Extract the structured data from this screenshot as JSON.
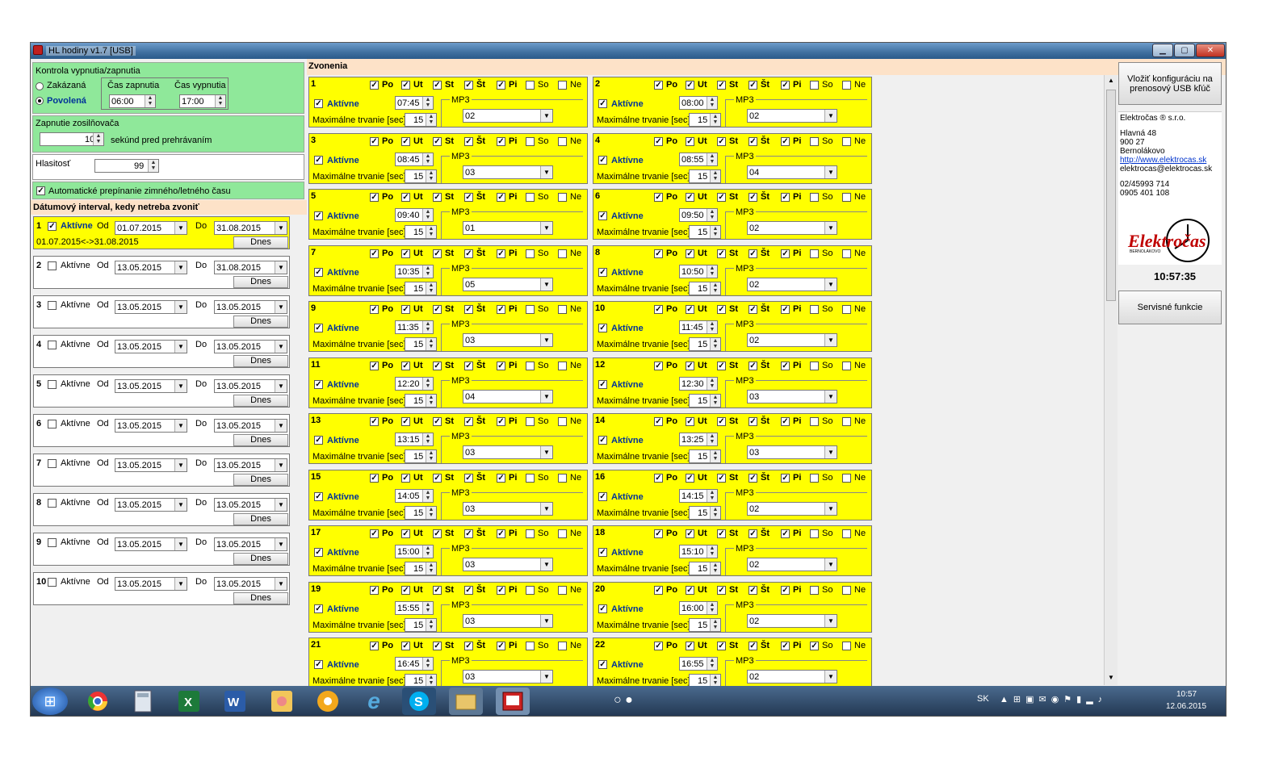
{
  "window": {
    "title": "HL hodiny v1.7  [USB]"
  },
  "power": {
    "heading": "Kontrola vypnutia/zapnutia",
    "disabled": "Zakázaná",
    "enabled": "Povolená",
    "on_time_label": "Čas zapnutia",
    "off_time_label": "Čas vypnutia",
    "on_time": "06:00",
    "off_time": "17:00"
  },
  "amp": {
    "heading": "Zapnutie zosilňovača",
    "value": "10",
    "suffix": "sekúnd pred prehrávaním"
  },
  "volume": {
    "label": "Hlasitosť",
    "value": "99"
  },
  "dst": {
    "label": "Automatické prepínanie zimného/letného času"
  },
  "dates": {
    "heading": "Dátumový interval, kedy netreba zvoniť",
    "active_label": "Aktívne",
    "from_label": "Od",
    "to_label": "Do",
    "today_label": "Dnes",
    "items": [
      {
        "n": "1",
        "from": "01.07.2015",
        "to": "31.08.2015",
        "active": true,
        "range": "01.07.2015<->31.08.2015"
      },
      {
        "n": "2",
        "from": "13.05.2015",
        "to": "31.08.2015",
        "active": false,
        "range": ""
      },
      {
        "n": "3",
        "from": "13.05.2015",
        "to": "13.05.2015",
        "active": false,
        "range": ""
      },
      {
        "n": "4",
        "from": "13.05.2015",
        "to": "13.05.2015",
        "active": false,
        "range": ""
      },
      {
        "n": "5",
        "from": "13.05.2015",
        "to": "13.05.2015",
        "active": false,
        "range": ""
      },
      {
        "n": "6",
        "from": "13.05.2015",
        "to": "13.05.2015",
        "active": false,
        "range": ""
      },
      {
        "n": "7",
        "from": "13.05.2015",
        "to": "13.05.2015",
        "active": false,
        "range": ""
      },
      {
        "n": "8",
        "from": "13.05.2015",
        "to": "13.05.2015",
        "active": false,
        "range": ""
      },
      {
        "n": "9",
        "from": "13.05.2015",
        "to": "13.05.2015",
        "active": false,
        "range": ""
      },
      {
        "n": "10",
        "from": "13.05.2015",
        "to": "13.05.2015",
        "active": false,
        "range": ""
      }
    ]
  },
  "bells": {
    "heading": "Zvonenia",
    "active_label": "Aktívne",
    "duration_label": "Maximálne trvanie [sec]",
    "mp3_label": "MP3",
    "days": [
      "Po",
      "Ut",
      "St",
      "Št",
      "Pi",
      "So",
      "Ne"
    ],
    "items": [
      {
        "n": "1",
        "time": "07:45",
        "dur": "15",
        "mp3": "02"
      },
      {
        "n": "2",
        "time": "08:00",
        "dur": "15",
        "mp3": "02"
      },
      {
        "n": "3",
        "time": "08:45",
        "dur": "15",
        "mp3": "03"
      },
      {
        "n": "4",
        "time": "08:55",
        "dur": "15",
        "mp3": "04"
      },
      {
        "n": "5",
        "time": "09:40",
        "dur": "15",
        "mp3": "01"
      },
      {
        "n": "6",
        "time": "09:50",
        "dur": "15",
        "mp3": "02"
      },
      {
        "n": "7",
        "time": "10:35",
        "dur": "15",
        "mp3": "05"
      },
      {
        "n": "8",
        "time": "10:50",
        "dur": "15",
        "mp3": "02"
      },
      {
        "n": "9",
        "time": "11:35",
        "dur": "15",
        "mp3": "03"
      },
      {
        "n": "10",
        "time": "11:45",
        "dur": "15",
        "mp3": "02"
      },
      {
        "n": "11",
        "time": "12:20",
        "dur": "15",
        "mp3": "04"
      },
      {
        "n": "12",
        "time": "12:30",
        "dur": "15",
        "mp3": "03"
      },
      {
        "n": "13",
        "time": "13:15",
        "dur": "15",
        "mp3": "03"
      },
      {
        "n": "14",
        "time": "13:25",
        "dur": "15",
        "mp3": "03"
      },
      {
        "n": "15",
        "time": "14:05",
        "dur": "15",
        "mp3": "03"
      },
      {
        "n": "16",
        "time": "14:15",
        "dur": "15",
        "mp3": "02"
      },
      {
        "n": "17",
        "time": "15:00",
        "dur": "15",
        "mp3": "03"
      },
      {
        "n": "18",
        "time": "15:10",
        "dur": "15",
        "mp3": "02"
      },
      {
        "n": "19",
        "time": "15:55",
        "dur": "15",
        "mp3": "03"
      },
      {
        "n": "20",
        "time": "16:00",
        "dur": "15",
        "mp3": "02"
      },
      {
        "n": "21",
        "time": "16:45",
        "dur": "15",
        "mp3": "03"
      },
      {
        "n": "22",
        "time": "16:55",
        "dur": "15",
        "mp3": "02",
        "so": true
      }
    ]
  },
  "right": {
    "usb_button": "Vložiť konfiguráciu na prenosový USB kľúč",
    "company": "Elektročas ® s.r.o.",
    "street": "Hlavná 48",
    "zip": "900 27",
    "city": "Bernolákovo",
    "url": "http://www.elektrocas.sk",
    "email": "elektrocas@elektrocas.sk",
    "phone1": "02/45993 714",
    "phone2": "0905 401 108",
    "logo": "Elektročas",
    "logo_sub": "BERNOLÁKOVO",
    "clock": "10:57:35",
    "service_button": "Servisné funkcie"
  },
  "taskbar": {
    "lang": "SK",
    "time": "10:57",
    "date": "12.06.2015"
  }
}
